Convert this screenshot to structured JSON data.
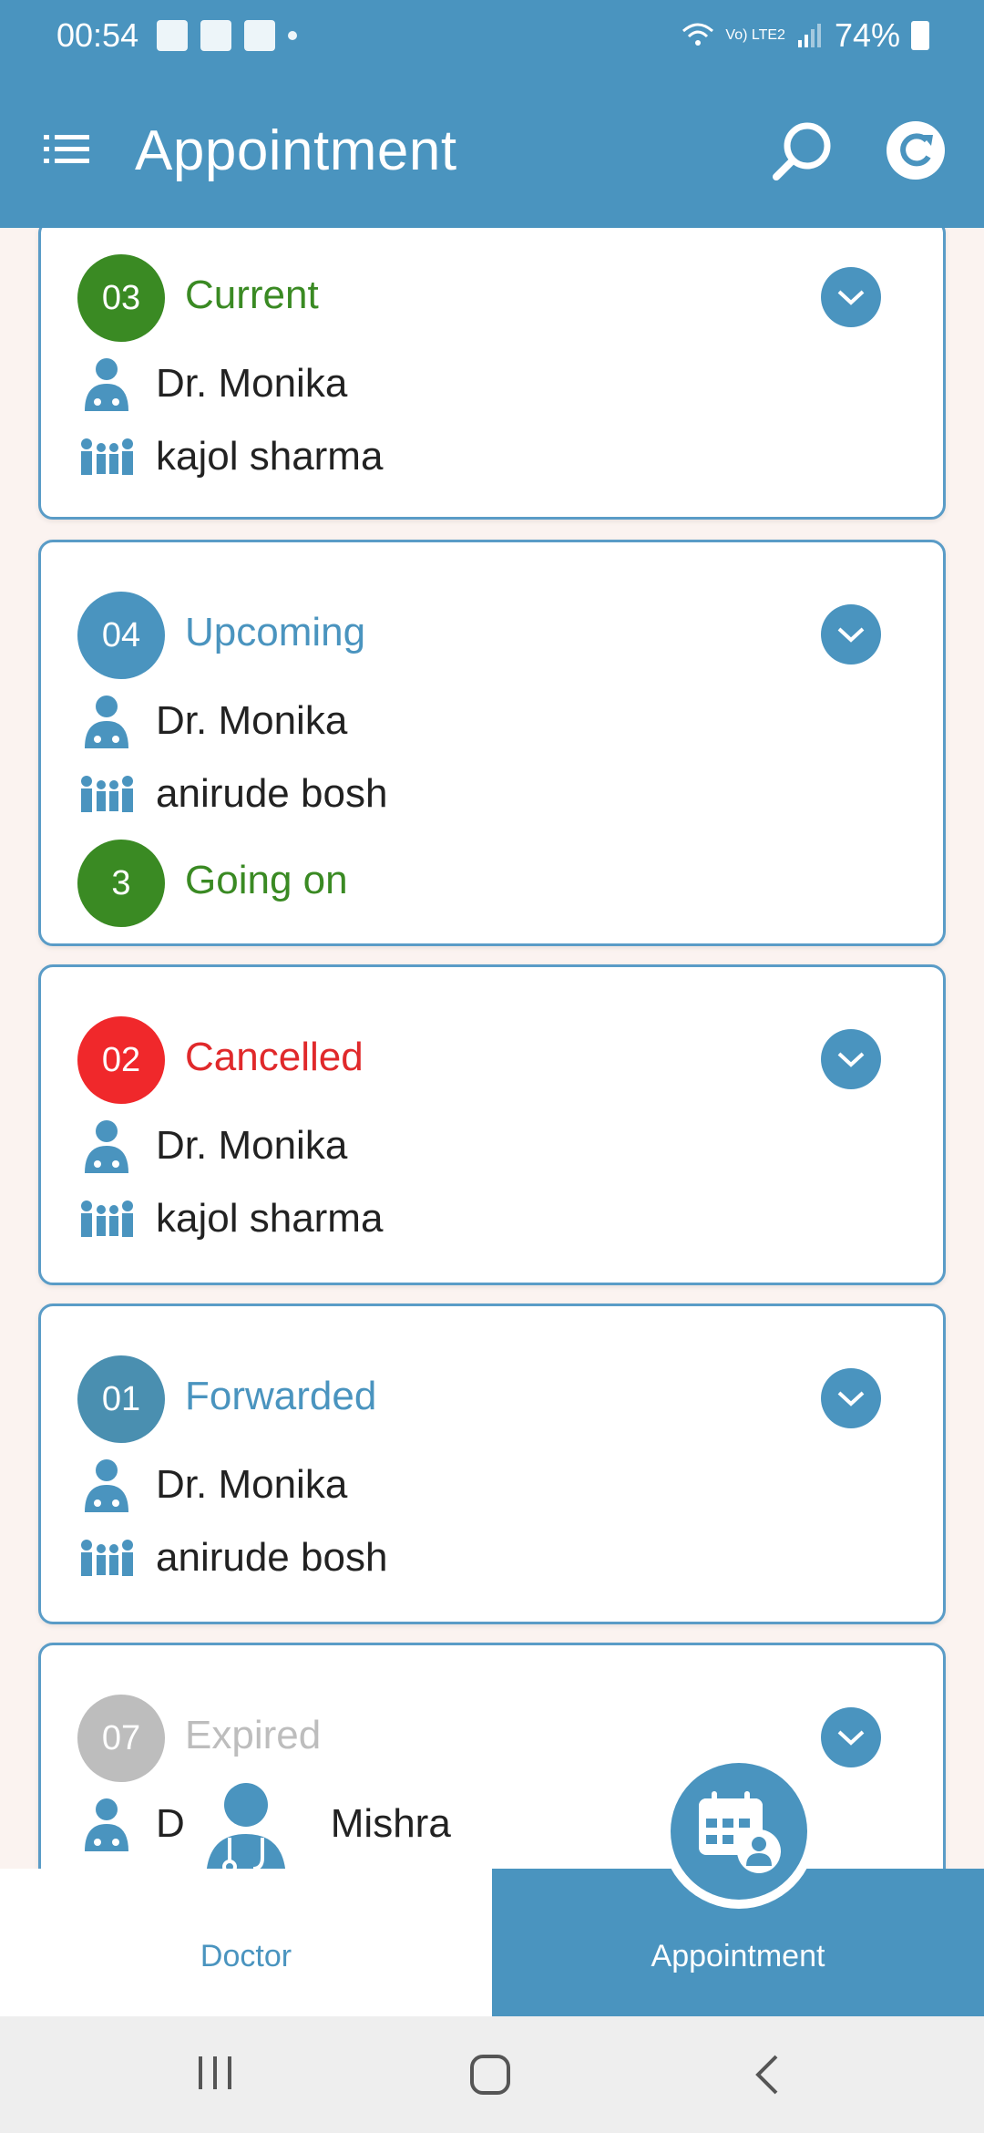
{
  "status_bar": {
    "time": "00:54",
    "network": "Vo) LTE2",
    "battery": "74%"
  },
  "app_bar": {
    "title": "Appointment"
  },
  "appointments": [
    {
      "number": "03",
      "status": "Current",
      "status_color": "#3a8a23",
      "badge_color": "#3a8a23",
      "doctor": "Dr. Monika",
      "patient": "kajol sharma"
    },
    {
      "number": "04",
      "status": "Upcoming",
      "status_color": "#4a94bf",
      "badge_color": "#4a94bf",
      "doctor": "Dr. Monika",
      "patient": "anirude bosh",
      "sub_number": "3",
      "sub_status": "Going on",
      "sub_color": "#3a8a23"
    },
    {
      "number": "02",
      "status": "Cancelled",
      "status_color": "#e0292b",
      "badge_color": "#f0282b",
      "doctor": "Dr. Monika",
      "patient": "kajol sharma"
    },
    {
      "number": "01",
      "status": "Forwarded",
      "status_color": "#4a94bf",
      "badge_color": "#4a8fb0",
      "doctor": "Dr. Monika",
      "patient": "anirude bosh"
    },
    {
      "number": "07",
      "status": "Expired",
      "status_color": "#bdbdbd",
      "badge_color": "#bdbdbd",
      "doctor_partial": "D",
      "patient_partial": "Mishra"
    }
  ],
  "bottom_nav": {
    "doctor_label": "Doctor",
    "appointment_label": "Appointment"
  },
  "colors": {
    "primary": "#4a94bf",
    "background": "#fbf3f0",
    "green": "#3a8a23",
    "red": "#f0282b",
    "grey": "#bdbdbd"
  }
}
